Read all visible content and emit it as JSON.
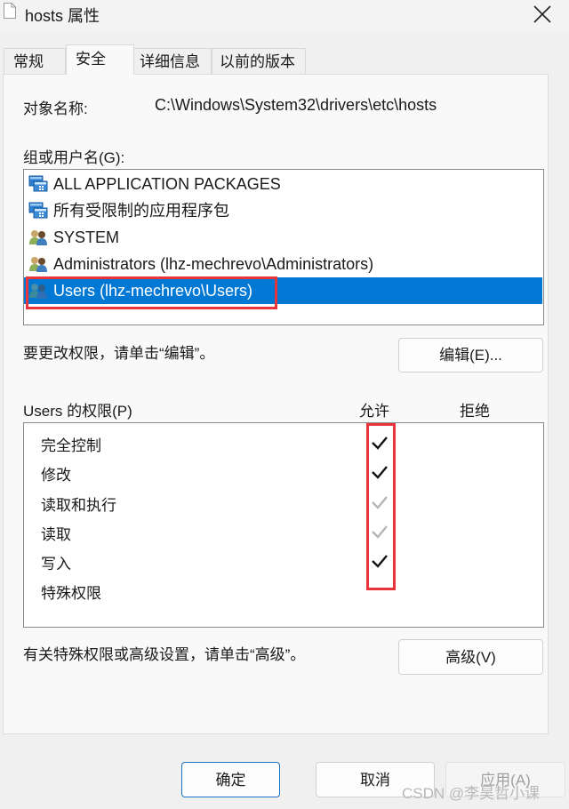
{
  "window": {
    "title": "hosts 属性",
    "file_icon": "document-icon",
    "close_icon": "close-icon"
  },
  "tabs": [
    {
      "label": "常规",
      "active": false
    },
    {
      "label": "安全",
      "active": true
    },
    {
      "label": "详细信息",
      "active": false
    },
    {
      "label": "以前的版本",
      "active": false
    }
  ],
  "object_name": {
    "label": "对象名称:",
    "value": "C:\\Windows\\System32\\drivers\\etc\\hosts"
  },
  "groups": {
    "label": "组或用户名(G):",
    "items": [
      {
        "name": "ALL APPLICATION PACKAGES",
        "icon": "app-package-icon",
        "selected": false
      },
      {
        "name": "所有受限制的应用程序包",
        "icon": "app-package-icon",
        "selected": false
      },
      {
        "name": "SYSTEM",
        "icon": "user-group-icon",
        "selected": false
      },
      {
        "name": "Administrators (lhz-mechrevo\\Administrators)",
        "icon": "user-group-icon",
        "selected": false
      },
      {
        "name": "Users (lhz-mechrevo\\Users)",
        "icon": "user-group-icon",
        "selected": true
      }
    ],
    "selection_color": "#0078d4"
  },
  "edit_hint": "要更改权限，请单击“编辑”。",
  "edit_button": "编辑(E)...",
  "permissions": {
    "label": "Users 的权限(P)",
    "allow_header": "允许",
    "deny_header": "拒绝",
    "rows": [
      {
        "name": "完全控制",
        "allow": "checked",
        "deny": "none"
      },
      {
        "name": "修改",
        "allow": "checked",
        "deny": "none"
      },
      {
        "name": "读取和执行",
        "allow": "inherited",
        "deny": "none"
      },
      {
        "name": "读取",
        "allow": "inherited",
        "deny": "none"
      },
      {
        "name": "写入",
        "allow": "checked",
        "deny": "none"
      },
      {
        "name": "特殊权限",
        "allow": "none",
        "deny": "none"
      }
    ]
  },
  "advanced_hint": "有关特殊权限或高级设置，请单击“高级”。",
  "advanced_button": "高级(V)",
  "footer": {
    "ok": "确定",
    "cancel": "取消",
    "apply": "应用(A)"
  },
  "annotation_color": "#e8343a",
  "watermark": "CSDN @李昊哲小课"
}
